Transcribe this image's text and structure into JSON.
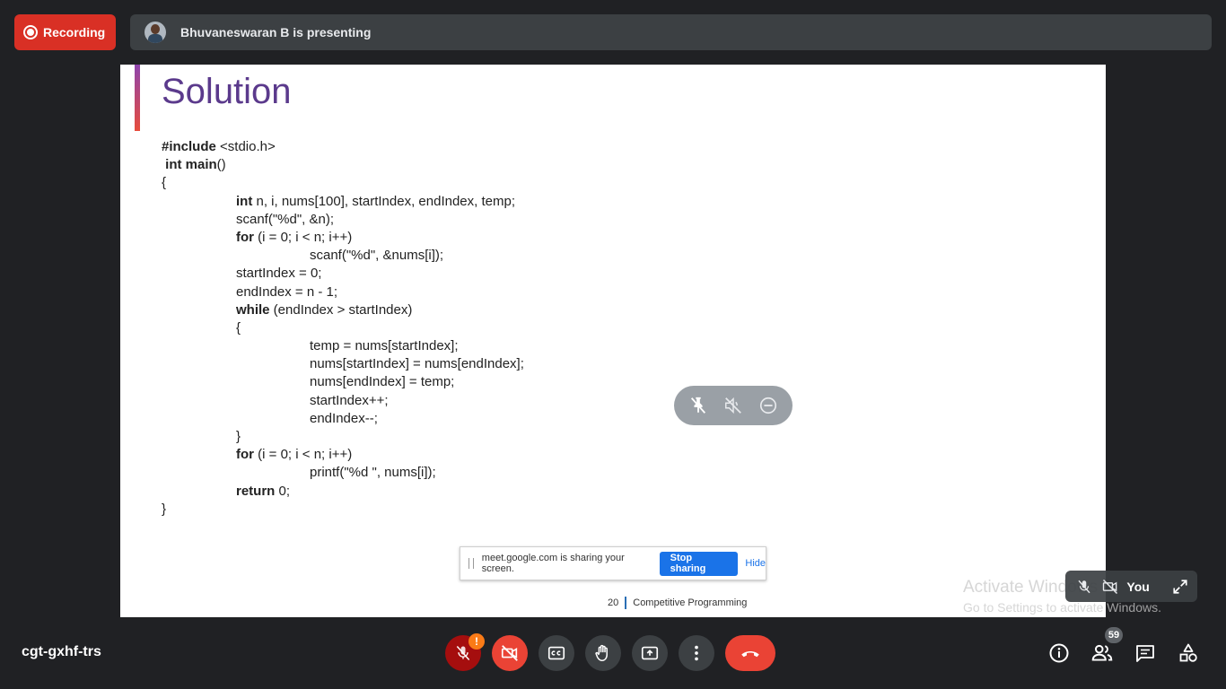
{
  "top": {
    "recording_label": "Recording",
    "presenter_text": "Bhuvaneswaran B is presenting"
  },
  "slide": {
    "title": "Solution",
    "code_lines": [
      [
        {
          "t": "#include",
          "kw": true
        },
        {
          "t": " <stdio.h>"
        }
      ],
      [
        {
          "t": " int main",
          "kw": true
        },
        {
          "t": "()"
        }
      ],
      [
        {
          "t": "{"
        }
      ],
      [
        {
          "t": "int",
          "kw": true
        },
        {
          "t": " n, i, nums[100], startIndex, endIndex, temp;"
        }
      ],
      [
        {
          "t": "scanf(\"%d\", &n);"
        }
      ],
      [
        {
          "t": "for",
          "kw": true
        },
        {
          "t": " (i = 0; i < n; i++)"
        }
      ],
      [
        {
          "t": "scanf(\"%d\", &nums[i]);"
        }
      ],
      [
        {
          "t": "startIndex = 0;"
        }
      ],
      [
        {
          "t": "endIndex = n - 1;"
        }
      ],
      [
        {
          "t": "while",
          "kw": true
        },
        {
          "t": " (endIndex > startIndex)"
        }
      ],
      [
        {
          "t": "{"
        }
      ],
      [
        {
          "t": "temp = nums[startIndex];"
        }
      ],
      [
        {
          "t": "nums[startIndex] = nums[endIndex];"
        }
      ],
      [
        {
          "t": "nums[endIndex] = temp;"
        }
      ],
      [
        {
          "t": "startIndex++;"
        }
      ],
      [
        {
          "t": "endIndex--;"
        }
      ],
      [
        {
          "t": "}"
        }
      ],
      [
        {
          "t": "for",
          "kw": true
        },
        {
          "t": " (i = 0; i < n; i++)"
        }
      ],
      [
        {
          "t": "printf(\"%d \", nums[i]);"
        }
      ],
      [
        {
          "t": "return",
          "kw": true
        },
        {
          "t": " 0;"
        }
      ],
      [
        {
          "t": "}"
        }
      ]
    ],
    "code_indents": [
      0,
      0,
      0,
      1,
      1,
      1,
      2,
      1,
      1,
      1,
      1,
      2,
      2,
      2,
      2,
      2,
      1,
      1,
      2,
      1,
      0
    ],
    "page_number": "20",
    "footer_text": "Competitive Programming"
  },
  "share_notice": {
    "message": "meet.google.com is sharing your screen.",
    "stop_label": "Stop sharing",
    "hide_label": "Hide"
  },
  "watermark": {
    "title": "Activate Windows",
    "subtitle": "Go to Settings to activate Windows."
  },
  "self_tile": {
    "label": "You"
  },
  "bottom": {
    "meeting_code": "cgt-gxhf-trs",
    "mic_warning": "!",
    "participants_count": "59"
  },
  "colors": {
    "background": "#202124",
    "recording_red": "#d93025",
    "control_gray": "#3c4043",
    "end_call_red": "#ea4335",
    "accent_blue": "#1a73e8",
    "slide_title": "#5b3a8c"
  },
  "icons": {
    "recording": "record-circle-icon",
    "mic": "mic-off-icon",
    "camera": "camera-off-icon",
    "captions": "captions-icon",
    "raise_hand": "raise-hand-icon",
    "present": "present-screen-icon",
    "more": "more-vert-icon",
    "end_call": "end-call-icon",
    "info": "info-icon",
    "people": "people-icon",
    "chat": "chat-icon",
    "activities": "activities-icon",
    "pin": "pin-off-icon",
    "mute": "volume-off-icon",
    "remove": "remove-circle-icon",
    "expand": "expand-icon"
  }
}
